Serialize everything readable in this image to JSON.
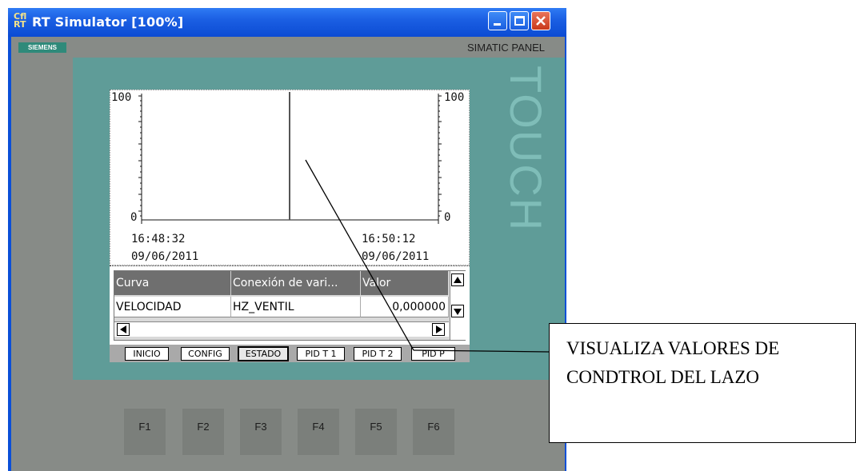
{
  "window": {
    "title_icon": "Cfl RT",
    "title": "RT Simulator [100%]"
  },
  "panel": {
    "brand_logo": "SIEMENS",
    "model_label": "SIMATIC PANEL",
    "side_label": "TOUCH"
  },
  "trend": {
    "y_left_max": "100",
    "y_left_min": "0",
    "y_right_max": "100",
    "y_right_min": "0",
    "x_start_time": "16:48:32",
    "x_start_date": "09/06/2011",
    "x_end_time": "16:50:12",
    "x_end_date": "09/06/2011"
  },
  "table": {
    "columns": [
      "Curva",
      "Conexión de vari...",
      "Valor"
    ],
    "rows": [
      [
        "VELOCIDAD",
        "HZ_VENTIL",
        "0,000000"
      ]
    ]
  },
  "nav": {
    "buttons": [
      "INICIO",
      "CONFIG",
      "ESTADO",
      "PID T 1",
      "PID T 2",
      "PID P"
    ],
    "active": "ESTADO"
  },
  "function_keys": [
    "F1",
    "F2",
    "F3",
    "F4",
    "F5",
    "F6"
  ],
  "annotation": {
    "text": "VISUALIZA VALORES DE CONDTROL DEL LAZO"
  },
  "colors": {
    "window_blue": "#0a4fd8",
    "bezel_teal": "#5f9c98",
    "panel_gray": "#878b87",
    "close_red": "#d9482a"
  },
  "icons": [
    "app-icon",
    "minimize-icon",
    "maximize-icon",
    "close-icon",
    "scroll-up-icon",
    "scroll-down-icon",
    "scroll-left-icon",
    "scroll-right-icon"
  ]
}
